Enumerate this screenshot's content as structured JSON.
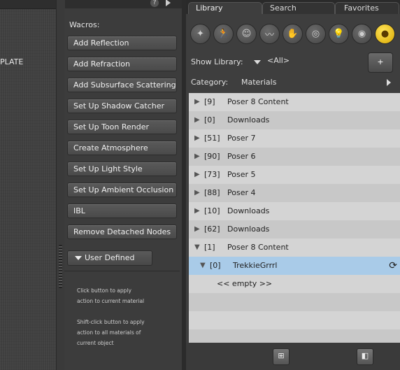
{
  "left": {
    "label": "PLATE"
  },
  "top": {
    "help": "?"
  },
  "wacros": {
    "title": "Wacros:",
    "buttons": [
      "Add Reflection",
      "Add Refraction",
      "Add Subsurface Scattering",
      "Set Up Shadow Catcher",
      "Set Up Toon Render",
      "Create Atmosphere",
      "Set Up Light Style",
      "Set Up Ambient Occlusion",
      "IBL",
      "Remove Detached Nodes"
    ],
    "user_defined": "User Defined",
    "hint1_line1": "Click button to apply",
    "hint1_line2": "action to current material",
    "hint2_line1": "Shift-click button to apply",
    "hint2_line2": "action to all materials of",
    "hint2_line3": "current object"
  },
  "library": {
    "tabs": [
      "Library",
      "Search",
      "Favorites"
    ],
    "category_icons": [
      "figures-icon",
      "poses-icon",
      "faces-icon",
      "hair-icon",
      "hands-icon",
      "props-icon",
      "lights-icon",
      "cameras-icon",
      "materials-icon"
    ],
    "show_library_label": "Show Library:",
    "show_library_value": "<All>",
    "folder_button": "+",
    "category_label": "Category:",
    "category_value": "Materials",
    "rows": [
      {
        "count": "[9]",
        "name": "Poser 8 Content",
        "expander": "▶"
      },
      {
        "count": "[0]",
        "name": "Downloads",
        "expander": "▶"
      },
      {
        "count": "[51]",
        "name": "Poser 7",
        "expander": "▶"
      },
      {
        "count": "[90]",
        "name": "Poser 6",
        "expander": "▶"
      },
      {
        "count": "[73]",
        "name": "Poser 5",
        "expander": "▶"
      },
      {
        "count": "[88]",
        "name": "Poser 4",
        "expander": "▶"
      },
      {
        "count": "[10]",
        "name": "Downloads",
        "expander": "▶"
      },
      {
        "count": "[62]",
        "name": "Downloads",
        "expander": "▶"
      },
      {
        "count": "[1]",
        "name": "Poser 8 Content",
        "expander": "▼"
      },
      {
        "count": "[0]",
        "name": "TrekkieGrrrl",
        "expander": "▼"
      },
      {
        "count": "",
        "name": "<< empty >>",
        "expander": ""
      }
    ],
    "selected_accent": "#a9cbe8"
  }
}
